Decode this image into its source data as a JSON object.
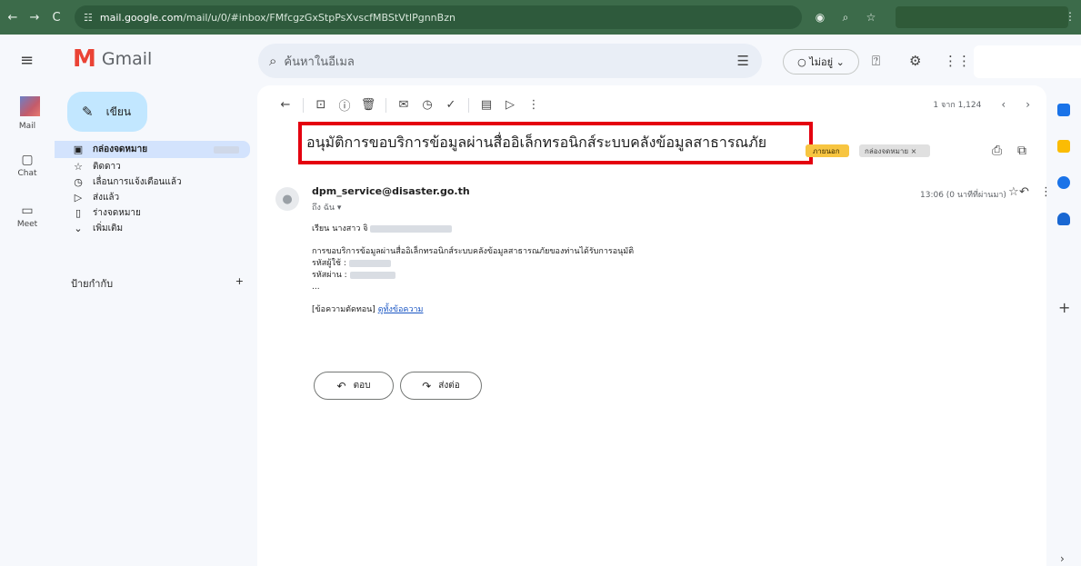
{
  "browser": {
    "url_host": "mail.google.com",
    "url_path": "/mail/u/0/#inbox/FMfcgzGxStpPsXvscfMBStVtlPgnnBzn"
  },
  "header": {
    "app_name": "Gmail",
    "search_placeholder": "ค้นหาในอีเมล",
    "status_label": "ไม่อยู่"
  },
  "rail": {
    "mail": "Mail",
    "chat": "Chat",
    "meet": "Meet"
  },
  "sidebar": {
    "compose": "เขียน",
    "items": [
      {
        "label": "กล่องจดหมาย",
        "icon": "inbox-icon"
      },
      {
        "label": "ติดดาว",
        "icon": "star-icon"
      },
      {
        "label": "เลื่อนการแจ้งเตือนแล้ว",
        "icon": "clock-icon"
      },
      {
        "label": "ส่งแล้ว",
        "icon": "send-icon"
      },
      {
        "label": "ร่างจดหมาย",
        "icon": "file-icon"
      },
      {
        "label": "เพิ่มเติม",
        "icon": "chevron-down-icon"
      }
    ],
    "labels_heading": "ป้ายกำกับ"
  },
  "toolbar": {
    "pager": "1 จาก 1,124"
  },
  "email": {
    "subject": "อนุมัติการขอบริการข้อมูลผ่านสื่ออิเล็กทรอนิกส์ระบบคลังข้อมูลสาธารณภัย",
    "tag_external": "ภายนอก",
    "tag_inbox": "กล่องจดหมาย ×",
    "sender": "dpm_service@disaster.go.th",
    "to": "ถึง ฉัน ▾",
    "time": "13:06 (0 นาทีที่ผ่านมา)",
    "greeting": "เรียน นางสาว จิ",
    "line1": "การขอบริการข้อมูลผ่านสื่ออิเล็กทรอนิกส์ระบบคลังข้อมูลสาธารณภัยของท่านได้รับการอนุมัติ",
    "user_label": "รหัสผู้ใช้ :",
    "pass_label": "รหัสผ่าน :",
    "ellipsis": "...",
    "trimmed": "[ข้อความตัดทอน]",
    "view_full": "ดูทั้งข้อความ",
    "reply": "ตอบ",
    "forward": "ส่งต่อ"
  },
  "colors": {
    "highlight_box": "#e4000f",
    "tag_external": "#f7c541"
  }
}
